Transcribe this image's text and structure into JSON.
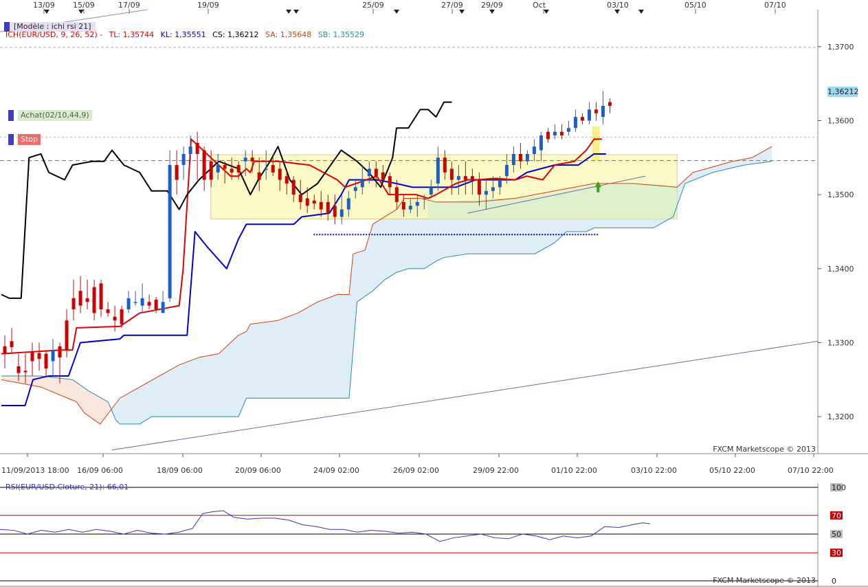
{
  "header_dates": [
    "13/09",
    "15/09",
    "17/09",
    "19/09",
    "25/09",
    "27/09",
    "29/09",
    "Oct",
    "03/10",
    "05/10",
    "07/10"
  ],
  "bottom_dates": [
    "11/09/2013 18:00",
    "16/09 06:00",
    "18/09 06:00",
    "20/09 06:00",
    "24/09 02:00",
    "26/09 02:00",
    "29/09 22:00",
    "01/10 22:00",
    "03/10 22:00",
    "05/10 22:00",
    "07/10 22:00"
  ],
  "model_label": "[Modèle : ichi rsi 21]",
  "indicator": {
    "name": "ICH(EUR/USD, 9, 26, 52) -",
    "tl": "TL: 1,35744",
    "kl": "KL: 1,35551",
    "cs": "CS: 1,36212",
    "sa": "SA: 1,35648",
    "sb": "SB: 1,35529"
  },
  "tags": {
    "buy": "Achat(02/10,44,9)",
    "stop": "Stop"
  },
  "current_price": "1,36212",
  "copyright_main": "FXCM Marketscope © 2013",
  "copyright_rsi": "FXCM Marketscope © 2013",
  "rsi": {
    "label": "RSI(EUR/USD.Cloture, 21): 66,01",
    "levels": [
      "100",
      "70",
      "50",
      "30",
      "0"
    ]
  },
  "colors": {
    "tenkan": "#e00000",
    "kijun": "#0000cc",
    "chikou": "#000000",
    "senkou_a": "#d04010",
    "senkou_b": "#2a8ab0",
    "bull": "#1a5fd0",
    "bear": "#d00000",
    "rsi": "#3333bb"
  },
  "chart_data": {
    "type": "line",
    "title": "",
    "xlabel": "",
    "ylabel": "",
    "ylim": [
      1.315,
      1.375
    ],
    "yticks": [
      "1,3700",
      "1,3600",
      "1,3500",
      "1,3400",
      "1,3300",
      "1,3200"
    ],
    "y_tick_values": [
      1.37,
      1.36,
      1.35,
      1.34,
      1.33,
      1.32
    ],
    "n_bars": 156,
    "tenkan": [
      [
        0,
        1.3285
      ],
      [
        15,
        1.329
      ],
      [
        18,
        1.329
      ],
      [
        19,
        1.332
      ],
      [
        30,
        1.3322
      ],
      [
        35,
        1.334
      ],
      [
        45,
        1.335
      ],
      [
        46,
        1.34
      ],
      [
        48,
        1.3575
      ],
      [
        58,
        1.3525
      ],
      [
        60,
        1.3525
      ],
      [
        62,
        1.3535
      ],
      [
        63,
        1.353
      ],
      [
        64,
        1.3545
      ],
      [
        70,
        1.3545
      ],
      [
        78,
        1.354
      ],
      [
        85,
        1.352
      ],
      [
        87,
        1.351
      ],
      [
        95,
        1.3525
      ],
      [
        98,
        1.35
      ],
      [
        105,
        1.35
      ],
      [
        108,
        1.3495
      ],
      [
        110,
        1.35
      ],
      [
        115,
        1.3515
      ],
      [
        118,
        1.352
      ],
      [
        120,
        1.352
      ],
      [
        125,
        1.3522
      ],
      [
        130,
        1.352
      ],
      [
        133,
        1.3525
      ],
      [
        137,
        1.352
      ],
      [
        140,
        1.354
      ],
      [
        145,
        1.3545
      ],
      [
        148,
        1.356
      ],
      [
        150,
        1.3575
      ],
      [
        152,
        1.3575
      ]
    ],
    "kijun": [
      [
        0,
        1.3215
      ],
      [
        6,
        1.3215
      ],
      [
        8,
        1.325
      ],
      [
        12,
        1.3255
      ],
      [
        17,
        1.3255
      ],
      [
        19,
        1.3285
      ],
      [
        20,
        1.33
      ],
      [
        30,
        1.3305
      ],
      [
        31,
        1.331
      ],
      [
        47,
        1.331
      ],
      [
        49,
        1.345
      ],
      [
        52,
        1.343
      ],
      [
        57,
        1.34
      ],
      [
        60,
        1.344
      ],
      [
        62,
        1.346
      ],
      [
        74,
        1.346
      ],
      [
        76,
        1.347
      ],
      [
        83,
        1.3475
      ],
      [
        86,
        1.35
      ],
      [
        88,
        1.352
      ],
      [
        95,
        1.352
      ],
      [
        100,
        1.3515
      ],
      [
        104,
        1.351
      ],
      [
        110,
        1.351
      ],
      [
        115,
        1.351
      ],
      [
        120,
        1.352
      ],
      [
        130,
        1.352
      ],
      [
        133,
        1.353
      ],
      [
        140,
        1.354
      ],
      [
        146,
        1.354
      ],
      [
        150,
        1.3555
      ],
      [
        153,
        1.3555
      ]
    ],
    "chikou": [
      [
        0,
        1.3365
      ],
      [
        2,
        1.336
      ],
      [
        5,
        1.336
      ],
      [
        7,
        1.355
      ],
      [
        10,
        1.3555
      ],
      [
        12,
        1.353
      ],
      [
        16,
        1.352
      ],
      [
        18,
        1.354
      ],
      [
        23,
        1.3545
      ],
      [
        26,
        1.3545
      ],
      [
        28,
        1.356
      ],
      [
        31,
        1.354
      ],
      [
        35,
        1.353
      ],
      [
        38,
        1.3505
      ],
      [
        42,
        1.3505
      ],
      [
        45,
        1.348
      ],
      [
        47,
        1.35
      ],
      [
        50,
        1.352
      ],
      [
        55,
        1.3545
      ],
      [
        60,
        1.3535
      ],
      [
        63,
        1.35
      ],
      [
        65,
        1.352
      ],
      [
        68,
        1.3545
      ],
      [
        70,
        1.3565
      ],
      [
        73,
        1.352
      ],
      [
        76,
        1.35
      ],
      [
        80,
        1.3515
      ],
      [
        84,
        1.3545
      ],
      [
        86,
        1.356
      ],
      [
        90,
        1.3545
      ],
      [
        93,
        1.353
      ],
      [
        96,
        1.351
      ],
      [
        99,
        1.355
      ],
      [
        100,
        1.359
      ],
      [
        103,
        1.359
      ],
      [
        106,
        1.3615
      ],
      [
        108,
        1.3615
      ],
      [
        110,
        1.3605
      ],
      [
        112,
        1.3625
      ],
      [
        114,
        1.3625
      ]
    ],
    "senkou_a": [
      [
        0,
        1.325
      ],
      [
        10,
        1.324
      ],
      [
        19,
        1.322
      ],
      [
        21,
        1.3205
      ],
      [
        25,
        1.319
      ],
      [
        30,
        1.3225
      ],
      [
        35,
        1.324
      ],
      [
        40,
        1.3255
      ],
      [
        45,
        1.327
      ],
      [
        50,
        1.328
      ],
      [
        55,
        1.3285
      ],
      [
        60,
        1.331
      ],
      [
        62,
        1.3315
      ],
      [
        63,
        1.3325
      ],
      [
        70,
        1.333
      ],
      [
        75,
        1.334
      ],
      [
        80,
        1.3355
      ],
      [
        85,
        1.3365
      ],
      [
        88,
        1.3365
      ],
      [
        89,
        1.342
      ],
      [
        92,
        1.3425
      ],
      [
        94,
        1.346
      ],
      [
        97,
        1.347
      ],
      [
        100,
        1.348
      ],
      [
        102,
        1.3495
      ],
      [
        106,
        1.3495
      ],
      [
        110,
        1.349
      ],
      [
        115,
        1.349
      ],
      [
        120,
        1.349
      ],
      [
        130,
        1.3495
      ],
      [
        135,
        1.35
      ],
      [
        145,
        1.351
      ],
      [
        150,
        1.3515
      ],
      [
        160,
        1.3515
      ],
      [
        171,
        1.351
      ],
      [
        175,
        1.353
      ],
      [
        185,
        1.3545
      ],
      [
        190,
        1.355
      ],
      [
        195,
        1.3565
      ]
    ],
    "senkou_b": [
      [
        0,
        1.3255
      ],
      [
        10,
        1.3255
      ],
      [
        18,
        1.325
      ],
      [
        22,
        1.3235
      ],
      [
        27,
        1.322
      ],
      [
        29,
        1.3195
      ],
      [
        30,
        1.319
      ],
      [
        35,
        1.319
      ],
      [
        38,
        1.32
      ],
      [
        60,
        1.32
      ],
      [
        62,
        1.3225
      ],
      [
        88,
        1.3225
      ],
      [
        90,
        1.3355
      ],
      [
        94,
        1.337
      ],
      [
        97,
        1.3385
      ],
      [
        100,
        1.3395
      ],
      [
        103,
        1.34
      ],
      [
        107,
        1.34
      ],
      [
        110,
        1.341
      ],
      [
        112,
        1.3415
      ],
      [
        118,
        1.342
      ],
      [
        125,
        1.342
      ],
      [
        135,
        1.342
      ],
      [
        140,
        1.3435
      ],
      [
        143,
        1.345
      ],
      [
        148,
        1.345
      ],
      [
        150,
        1.3455
      ],
      [
        165,
        1.3455
      ],
      [
        170,
        1.347
      ],
      [
        173,
        1.3515
      ],
      [
        180,
        1.353
      ],
      [
        188,
        1.354
      ],
      [
        195,
        1.3545
      ]
    ],
    "candles": [
      [
        1,
        1.3295,
        1.3285,
        1.331,
        1.3265
      ],
      [
        3,
        1.3302,
        1.3294,
        1.332,
        1.3285
      ],
      [
        5,
        1.3268,
        1.3259,
        1.3285,
        1.3248
      ],
      [
        7,
        1.3262,
        1.326,
        1.3285,
        1.3245
      ],
      [
        9,
        1.3288,
        1.3275,
        1.33,
        1.3255
      ],
      [
        11,
        1.3286,
        1.3278,
        1.33,
        1.3262
      ],
      [
        13,
        1.3285,
        1.3265,
        1.329,
        1.3255
      ],
      [
        15,
        1.3275,
        1.329,
        1.3305,
        1.3255
      ],
      [
        17,
        1.3295,
        1.328,
        1.33,
        1.3245
      ],
      [
        19,
        1.333,
        1.329,
        1.3345,
        1.328
      ],
      [
        21,
        1.336,
        1.3345,
        1.3385,
        1.333
      ],
      [
        23,
        1.337,
        1.335,
        1.339,
        1.334
      ],
      [
        25,
        1.336,
        1.3355,
        1.3385,
        1.3345
      ],
      [
        27,
        1.3375,
        1.334,
        1.3385,
        1.333
      ],
      [
        29,
        1.338,
        1.3345,
        1.3385,
        1.3335
      ],
      [
        31,
        1.3345,
        1.334,
        1.3355,
        1.3335
      ],
      [
        33,
        1.3335,
        1.333,
        1.335,
        1.3315
      ],
      [
        35,
        1.3345,
        1.3325,
        1.335,
        1.332
      ],
      [
        37,
        1.3345,
        1.336,
        1.337,
        1.334
      ],
      [
        39,
        1.3355,
        1.3355,
        1.337,
        1.335
      ],
      [
        41,
        1.335,
        1.336,
        1.338,
        1.334
      ],
      [
        43,
        1.3355,
        1.335,
        1.3365,
        1.3345
      ],
      [
        45,
        1.3358,
        1.3345,
        1.3362,
        1.334
      ],
      [
        47,
        1.334,
        1.3355,
        1.337,
        1.3345
      ],
      [
        49,
        1.336,
        1.354,
        1.356,
        1.3355
      ],
      [
        51,
        1.354,
        1.352,
        1.356,
        1.35
      ],
      [
        53,
        1.354,
        1.3555,
        1.3565,
        1.352
      ],
      [
        55,
        1.3555,
        1.3565,
        1.358,
        1.3545
      ],
      [
        57,
        1.357,
        1.3555,
        1.3585,
        1.352
      ],
      [
        59,
        1.356,
        1.352,
        1.3565,
        1.3505
      ],
      [
        61,
        1.3545,
        1.352,
        1.356,
        1.351
      ],
      [
        63,
        1.353,
        1.354,
        1.3555,
        1.352
      ],
      [
        65,
        1.354,
        1.3535,
        1.3545,
        1.3515
      ],
      [
        67,
        1.3535,
        1.353,
        1.355,
        1.352
      ],
      [
        69,
        1.354,
        1.353,
        1.3545,
        1.352
      ],
      [
        71,
        1.3545,
        1.355,
        1.356,
        1.3525
      ],
      [
        73,
        1.355,
        1.3545,
        1.356,
        1.353
      ],
      [
        75,
        1.353,
        1.352,
        1.355,
        1.3505
      ],
      [
        77,
        1.3535,
        1.3535,
        1.356,
        1.352
      ],
      [
        79,
        1.354,
        1.353,
        1.355,
        1.3525
      ],
      [
        81,
        1.3535,
        1.352,
        1.3545,
        1.3505
      ],
      [
        83,
        1.3525,
        1.3515,
        1.3535,
        1.35
      ],
      [
        85,
        1.352,
        1.35,
        1.3525,
        1.349
      ],
      [
        87,
        1.35,
        1.349,
        1.352,
        1.348
      ],
      [
        89,
        1.3495,
        1.3485,
        1.351,
        1.3475
      ],
      [
        91,
        1.3492,
        1.3488,
        1.35,
        1.348
      ],
      [
        93,
        1.349,
        1.348,
        1.3505,
        1.347
      ],
      [
        95,
        1.349,
        1.3475,
        1.35,
        1.3465
      ],
      [
        97,
        1.3485,
        1.347,
        1.35,
        1.346
      ],
      [
        99,
        1.347,
        1.348,
        1.35,
        1.346
      ],
      [
        101,
        1.348,
        1.3495,
        1.3505,
        1.347
      ],
      [
        103,
        1.3505,
        1.351,
        1.352,
        1.3495
      ],
      [
        105,
        1.351,
        1.352,
        1.354,
        1.35
      ],
      [
        107,
        1.3525,
        1.3535,
        1.3545,
        1.3515
      ],
      [
        109,
        1.3535,
        1.3525,
        1.3545,
        1.351
      ],
      [
        111,
        1.353,
        1.352,
        1.354,
        1.3515
      ],
      [
        113,
        1.3525,
        1.351,
        1.353,
        1.35
      ],
      [
        115,
        1.351,
        1.349,
        1.352,
        1.348
      ],
      [
        117,
        1.349,
        1.348,
        1.35,
        1.347
      ],
      [
        119,
        1.348,
        1.3485,
        1.3495,
        1.3475
      ],
      [
        121,
        1.3485,
        1.349,
        1.35,
        1.347
      ],
      [
        123,
        1.3495,
        1.3495,
        1.35,
        1.348
      ],
      [
        125,
        1.35,
        1.351,
        1.352,
        1.3495
      ],
      [
        127,
        1.3515,
        1.355,
        1.3565,
        1.3505
      ],
      [
        129,
        1.355,
        1.353,
        1.356,
        1.352
      ],
      [
        131,
        1.3535,
        1.352,
        1.3545,
        1.35
      ],
      [
        133,
        1.352,
        1.3525,
        1.354,
        1.35
      ],
      [
        135,
        1.3525,
        1.352,
        1.3545,
        1.35
      ],
      [
        137,
        1.3525,
        1.352,
        1.3535,
        1.35
      ],
      [
        139,
        1.352,
        1.35,
        1.353,
        1.3485
      ],
      [
        141,
        1.35,
        1.3505,
        1.352,
        1.348
      ],
      [
        143,
        1.3505,
        1.351,
        1.3525,
        1.3495
      ],
      [
        145,
        1.351,
        1.352,
        1.3525,
        1.35
      ],
      [
        147,
        1.3525,
        1.354,
        1.3555,
        1.3515
      ],
      [
        149,
        1.354,
        1.3555,
        1.3565,
        1.353
      ],
      [
        151,
        1.3555,
        1.3545,
        1.357,
        1.3535
      ],
      [
        153,
        1.3545,
        1.3555,
        1.356,
        1.354
      ],
      [
        155,
        1.3555,
        1.3565,
        1.3575,
        1.3545
      ],
      [
        157,
        1.356,
        1.358,
        1.3585,
        1.3545
      ],
      [
        159,
        1.3585,
        1.3575,
        1.359,
        1.357
      ],
      [
        161,
        1.358,
        1.3585,
        1.3595,
        1.3575
      ],
      [
        163,
        1.3585,
        1.358,
        1.3595,
        1.3575
      ],
      [
        165,
        1.3585,
        1.359,
        1.36,
        1.358
      ],
      [
        167,
        1.359,
        1.3605,
        1.3615,
        1.3585
      ],
      [
        169,
        1.3605,
        1.36,
        1.361,
        1.3595
      ],
      [
        171,
        1.36,
        1.3615,
        1.3625,
        1.3595
      ],
      [
        173,
        1.3615,
        1.361,
        1.3625,
        1.36
      ],
      [
        175,
        1.3605,
        1.362,
        1.364,
        1.3595
      ],
      [
        177,
        1.3625,
        1.362,
        1.363,
        1.361
      ]
    ]
  }
}
